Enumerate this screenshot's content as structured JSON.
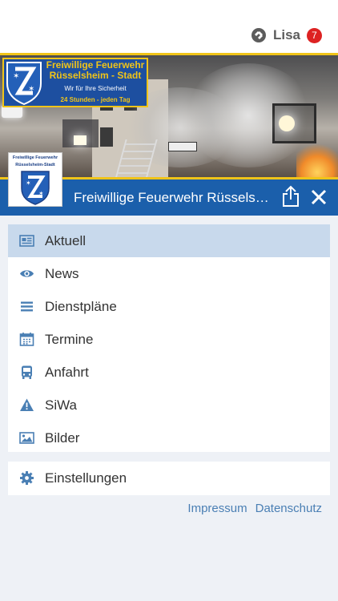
{
  "user": {
    "name": "Lisa",
    "badge_count": "7"
  },
  "banner": {
    "line1": "Freiwillige Feuerwehr",
    "line2": "Rüsselsheim - Stadt",
    "line3": "Wir für Ihre Sicherheit",
    "line4": "24 Stunden - jeden Tag"
  },
  "logo": {
    "line1": "Freiwillige Feuerwehr",
    "line2": "Rüsselsheim-Stadt"
  },
  "header": {
    "title": "Freiwillige Feuerwehr Rüsselsheim-Stadt"
  },
  "menu": {
    "items": [
      {
        "label": "Aktuell",
        "icon": "newspaper-icon",
        "active": true
      },
      {
        "label": "News",
        "icon": "eye-icon"
      },
      {
        "label": "Dienstpläne",
        "icon": "list-icon"
      },
      {
        "label": "Termine",
        "icon": "calendar-icon"
      },
      {
        "label": "Anfahrt",
        "icon": "bus-icon"
      },
      {
        "label": "SiWa",
        "icon": "warning-icon"
      },
      {
        "label": "Bilder",
        "icon": "image-icon"
      }
    ]
  },
  "settings": {
    "label": "Einstellungen",
    "icon": "gear-icon"
  },
  "footer": {
    "impressum": "Impressum",
    "datenschutz": "Datenschutz"
  },
  "colors": {
    "primary": "#1b5fab",
    "accent": "#f0c419",
    "active_row": "#c8d9ec",
    "icon": "#4a7fb4",
    "badge": "#dd2222",
    "background": "#eef1f6"
  }
}
